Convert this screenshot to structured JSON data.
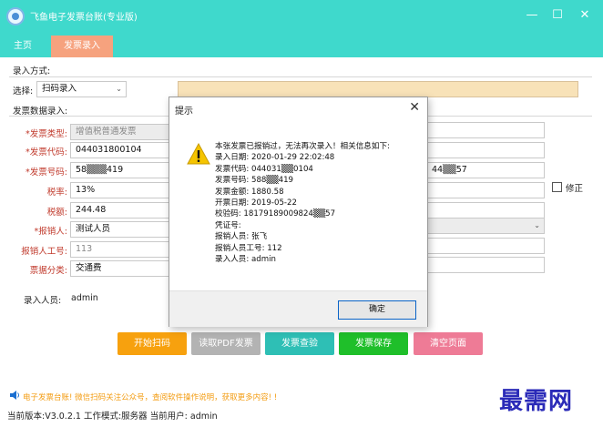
{
  "app": {
    "title": "飞鱼电子发票台账(专业版)",
    "minimize": "—",
    "maximize": "☐",
    "close": "✕"
  },
  "menu": {
    "home": "主页",
    "invoice_entry": "发票录入"
  },
  "entry_method": {
    "section_label": "录入方式:",
    "select_label": "选择:",
    "select_value": "扫码录入"
  },
  "invoice": {
    "section_label": "发票数据录入:",
    "type_label": "*发票类型:",
    "type_value": "增值税普通发票",
    "code_label": "*发票代码:",
    "code_value": "044031800104",
    "number_label": "*发票号码:",
    "number_value": "58▒▒▒419",
    "tax_rate_label": "税率:",
    "tax_rate_value": "13%",
    "tax_amount_label": "税额:",
    "tax_amount_value": "244.48",
    "reimburser_label": "*报销人:",
    "reimburser_value": "测试人员",
    "reimburser_id_label": "报销人工号:",
    "reimburser_id_value": "113",
    "category_label": "票据分类:",
    "category_value": "交通费",
    "right_partial_value": "44▒▒57",
    "correct_label": "修正"
  },
  "entry_person": {
    "label": "录入人员:",
    "value": "admin"
  },
  "buttons": {
    "start_scan": "开始扫码",
    "read_pdf": "读取PDF发票",
    "query": "发票查验",
    "save": "发票保存",
    "clear": "清空页面"
  },
  "notice": "电子发票台账!  微信扫码关注公众号，查阅软件操作说明，获取更多内容!      !",
  "status": "当前版本:V3.0.2.1  工作模式:服务器  当前用户: admin",
  "watermark": "最需网",
  "dialog": {
    "title": "提示",
    "close": "✕",
    "lines": [
      "本张发票已报销过，无法再次录入！相关信息如下:",
      "录入日期: 2020-01-29 22:02:48",
      "发票代码: 044031▒▒0104",
      "发票号码: 588▒▒419",
      "发票金额: 1880.58",
      "开票日期: 2019-05-22",
      "校验码: 18179189009824▒▒57",
      "凭证号:",
      "报销人员: 张飞",
      "报销人员工号: 112",
      "录入人员: admin"
    ],
    "ok": "确定"
  },
  "colors": {
    "teal": "#3fd9cc",
    "orange_tab": "#f6a27e",
    "btn_orange": "#f7a10e",
    "btn_gray": "#b3b3b3",
    "btn_teal": "#2ebfb5",
    "btn_green": "#1fbf2a",
    "btn_pink": "#ee7b96"
  }
}
